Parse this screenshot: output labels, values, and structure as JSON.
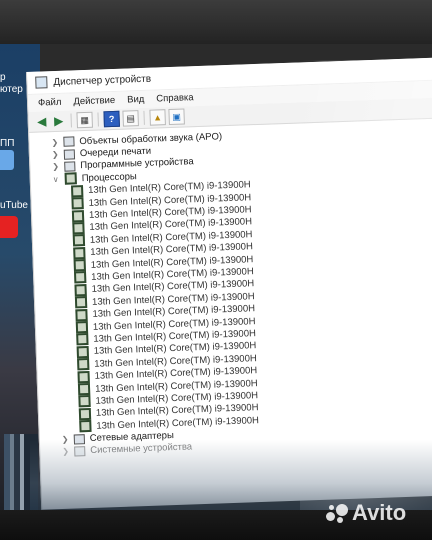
{
  "desktop": {
    "labels": [
      "р",
      "ютер",
      "ПП",
      "uTube"
    ]
  },
  "window": {
    "title": "Диспетчер устройств"
  },
  "menu": [
    "Файл",
    "Действие",
    "Вид",
    "Справка"
  ],
  "tree": {
    "top_items": [
      "Объекты обработки звука (APO)",
      "Очереди печати",
      "Программные устройства",
      "Процессоры"
    ],
    "processor_label": "13th Gen Intel(R) Core(TM) i9-13900H",
    "processor_count": 20,
    "bottom_items": [
      "Сетевые адаптеры",
      "Системные устройства"
    ]
  },
  "watermark": {
    "text": "Avito"
  },
  "colors": {
    "window_bg": "#ffffff",
    "proc_icon": "#2f4a2e",
    "toolbar_help": "#2d5fbf"
  }
}
